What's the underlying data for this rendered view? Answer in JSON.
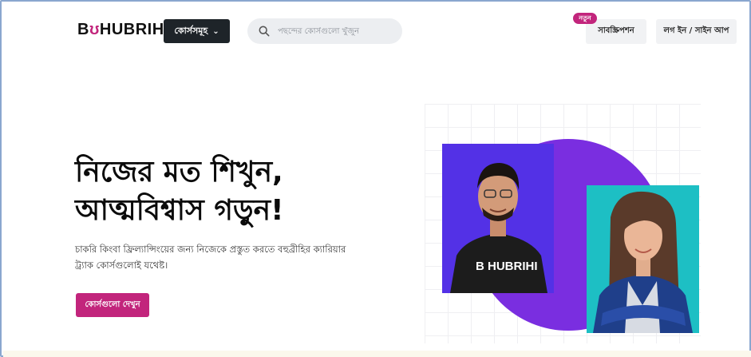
{
  "header": {
    "logo": {
      "prefix": "B",
      "accent": "̆",
      "rest": "HUBRIHI"
    },
    "courses_label": "কোর্সসমূহ",
    "search_placeholder": "পছন্দের কোর্সগুলো খুঁজুন",
    "new_badge": "নতুন",
    "subscription_label": "সাবস্ক্রিপশন",
    "login_label": "লগ ইন / সাইন আপ"
  },
  "hero": {
    "headline_line1": "নিজের মত শিখুন,",
    "headline_line2": "আত্মবিশ্বাস গড়ুন!",
    "description_line1": "চাকরি কিংবা ফ্রিল্যান্সিংয়ের জন্য নিজেকে প্রস্তুত করতে বহুব্রীহির ক্যারিয়ার",
    "description_line2": "ট্র্যাক কোর্সগুলোই যথেষ্ট।",
    "cta_label": "কোর্সগুলো দেখুন",
    "shirt_logo": "B HUBRIHI"
  },
  "colors": {
    "accent": "#c2257c",
    "dark": "#1e2429",
    "purple": "#7a2ee0",
    "teal": "#1dbfc4"
  }
}
